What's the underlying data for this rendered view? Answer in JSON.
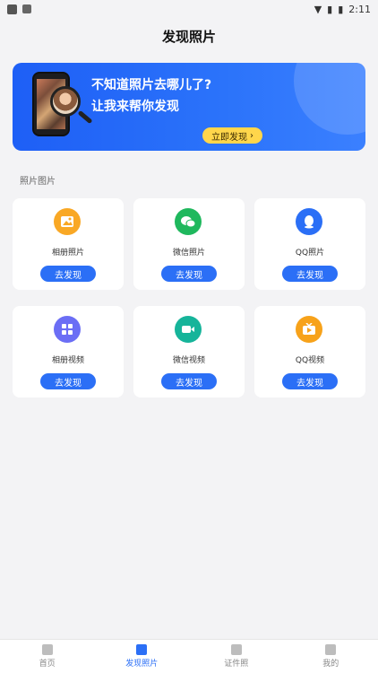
{
  "status_bar": {
    "time": "2:11"
  },
  "page_title": "发现照片",
  "banner": {
    "line1": "不知道照片去哪儿了?",
    "line2": "让我来帮你发现",
    "button_label": "立即发现"
  },
  "section_label": "照片图片",
  "cards": [
    {
      "label": "相册照片",
      "button": "去发现",
      "icon": "image-icon",
      "color": "#f9a825"
    },
    {
      "label": "微信照片",
      "button": "去发现",
      "icon": "wechat-icon",
      "color": "#1fb85d"
    },
    {
      "label": "QQ照片",
      "button": "去发现",
      "icon": "qq-icon",
      "color": "#2b6ff6"
    },
    {
      "label": "相册视频",
      "button": "去发现",
      "icon": "grid-icon",
      "color": "#6b6ef5"
    },
    {
      "label": "微信视频",
      "button": "去发现",
      "icon": "video-camera-icon",
      "color": "#16b49a"
    },
    {
      "label": "QQ视频",
      "button": "去发现",
      "icon": "tv-icon",
      "color": "#f7a21a"
    }
  ],
  "bottom_nav": [
    {
      "label": "首页",
      "icon": "home-icon",
      "active": false
    },
    {
      "label": "发现照片",
      "icon": "photo-icon",
      "active": true
    },
    {
      "label": "证件照",
      "icon": "id-photo-icon",
      "active": false
    },
    {
      "label": "我的",
      "icon": "profile-icon",
      "active": false
    }
  ]
}
